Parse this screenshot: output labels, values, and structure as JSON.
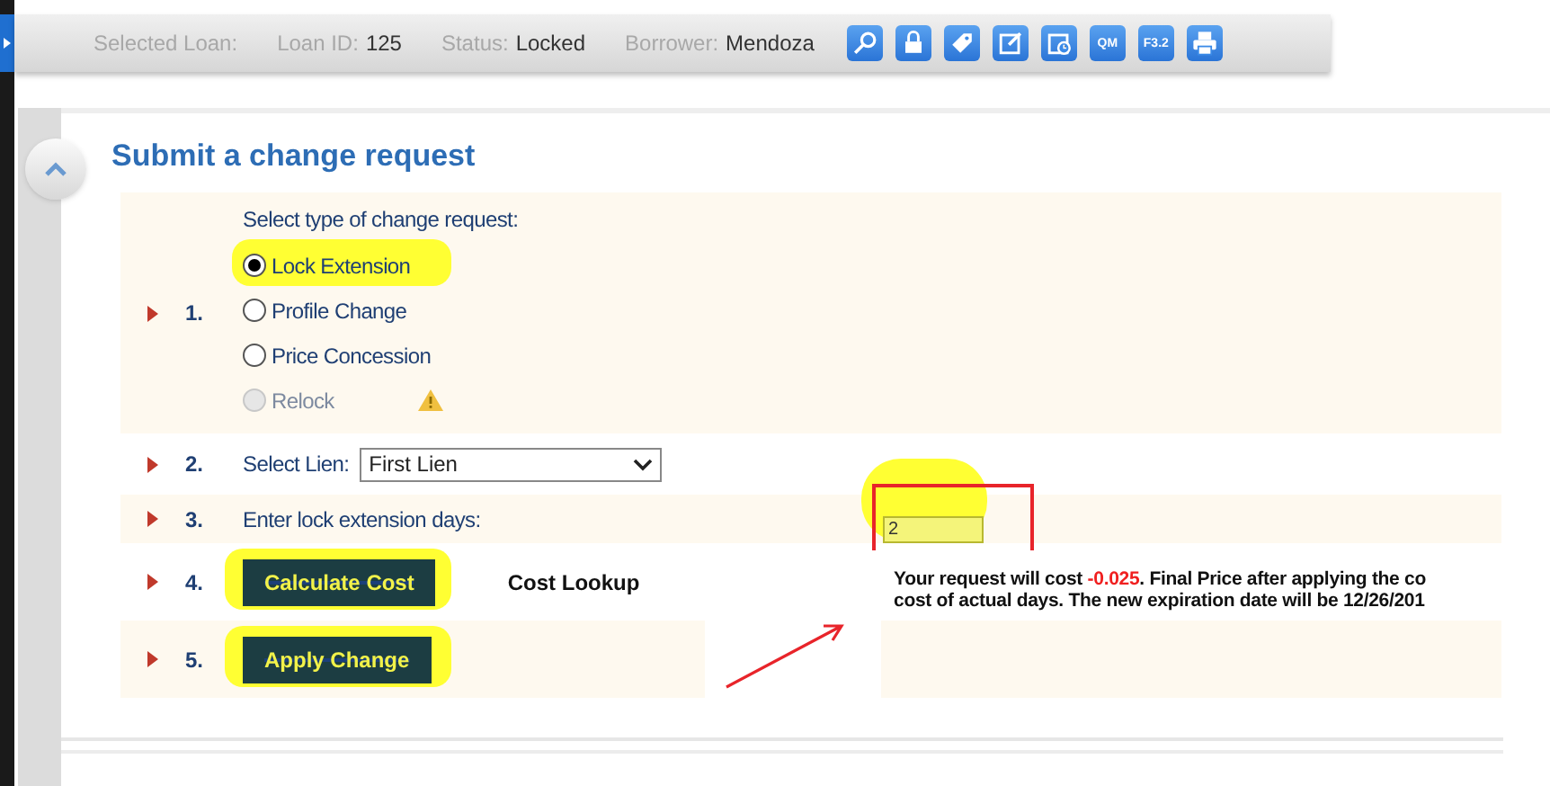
{
  "header": {
    "title": "Selected Loan:",
    "fields": [
      {
        "label": "Loan ID:",
        "value": "125"
      },
      {
        "label": "Status:",
        "value": "Locked"
      },
      {
        "label": "Borrower:",
        "value": "Mendoza"
      }
    ],
    "tools": [
      {
        "kind": "search"
      },
      {
        "kind": "lock"
      },
      {
        "kind": "tag"
      },
      {
        "kind": "edit"
      },
      {
        "kind": "clock"
      },
      {
        "kind": "text",
        "label": "QM"
      },
      {
        "kind": "text",
        "label": "F3.2"
      },
      {
        "kind": "print"
      }
    ]
  },
  "section": {
    "title": "Submit a change request",
    "expanded": true
  },
  "steps": [
    {
      "number": "1.",
      "kind": "radios",
      "label": "Select type of change request:",
      "options": [
        {
          "label": "Lock Extension",
          "selected": true,
          "disabled": false,
          "highlighted": true
        },
        {
          "label": "Profile Change",
          "selected": false,
          "disabled": false,
          "highlighted": false
        },
        {
          "label": "Price Concession",
          "selected": false,
          "disabled": false,
          "highlighted": false
        },
        {
          "label": "Relock",
          "selected": false,
          "disabled": true,
          "highlighted": false,
          "warning": true
        }
      ]
    },
    {
      "number": "2.",
      "kind": "select",
      "label": "Select Lien:",
      "value": "First Lien"
    },
    {
      "number": "3.",
      "kind": "input",
      "label": "Enter lock extension days:",
      "value": "2",
      "highlighted": true
    },
    {
      "number": "4.",
      "kind": "button",
      "button": "Calculate Cost",
      "highlighted": true,
      "link": "Cost Lookup",
      "message": {
        "before": "Your request will cost ",
        "amount": "-0.025",
        "after": ". Final Price after applying the co",
        "line2": "cost of actual days. The new expiration date will be 12/26/201"
      }
    },
    {
      "number": "5.",
      "kind": "button",
      "button": "Apply Change",
      "highlighted": true
    }
  ]
}
